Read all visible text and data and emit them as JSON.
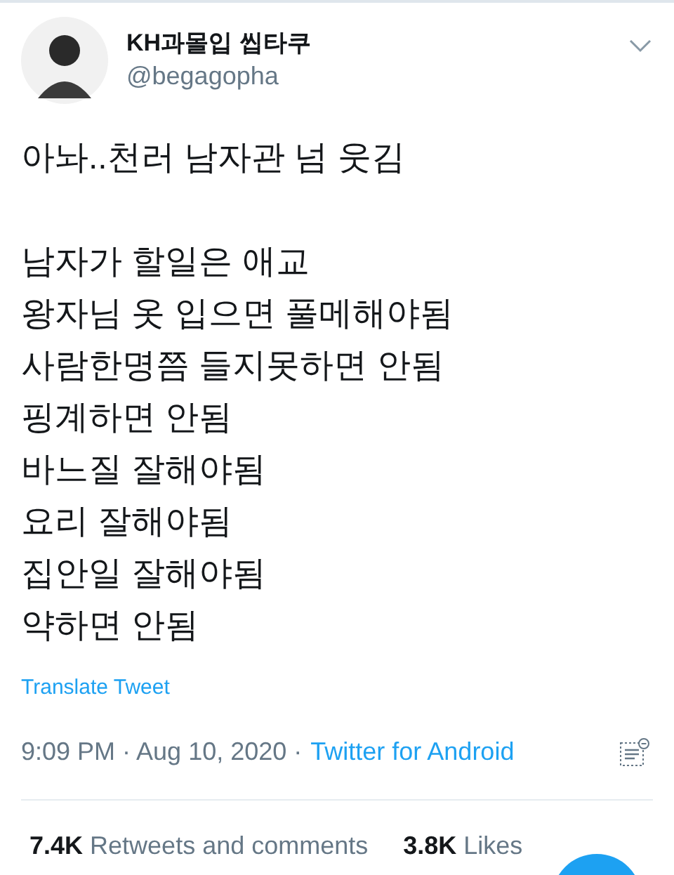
{
  "author": {
    "name": "KH과몰입 씹타쿠",
    "handle": "@begagopha"
  },
  "tweet": {
    "lead": "아놔..천러 남자관 넘 웃김",
    "lines": [
      "남자가 할일은 애교",
      "왕자님 옷 입으면 풀메해야됨",
      "사람한명쯤 들지못하면 안됨",
      "핑계하면 안됨",
      "바느질 잘해야됨",
      "요리 잘해야됨",
      "집안일 잘해야됨",
      "약하면 안됨"
    ]
  },
  "translate_link": "Translate Tweet",
  "meta": {
    "time": "9:09 PM · Aug 10, 2020 ·",
    "source": "Twitter for Android"
  },
  "stats": [
    "**7.4K** Retweets and comments",
    "**3.8K** Likes"
  ]
}
